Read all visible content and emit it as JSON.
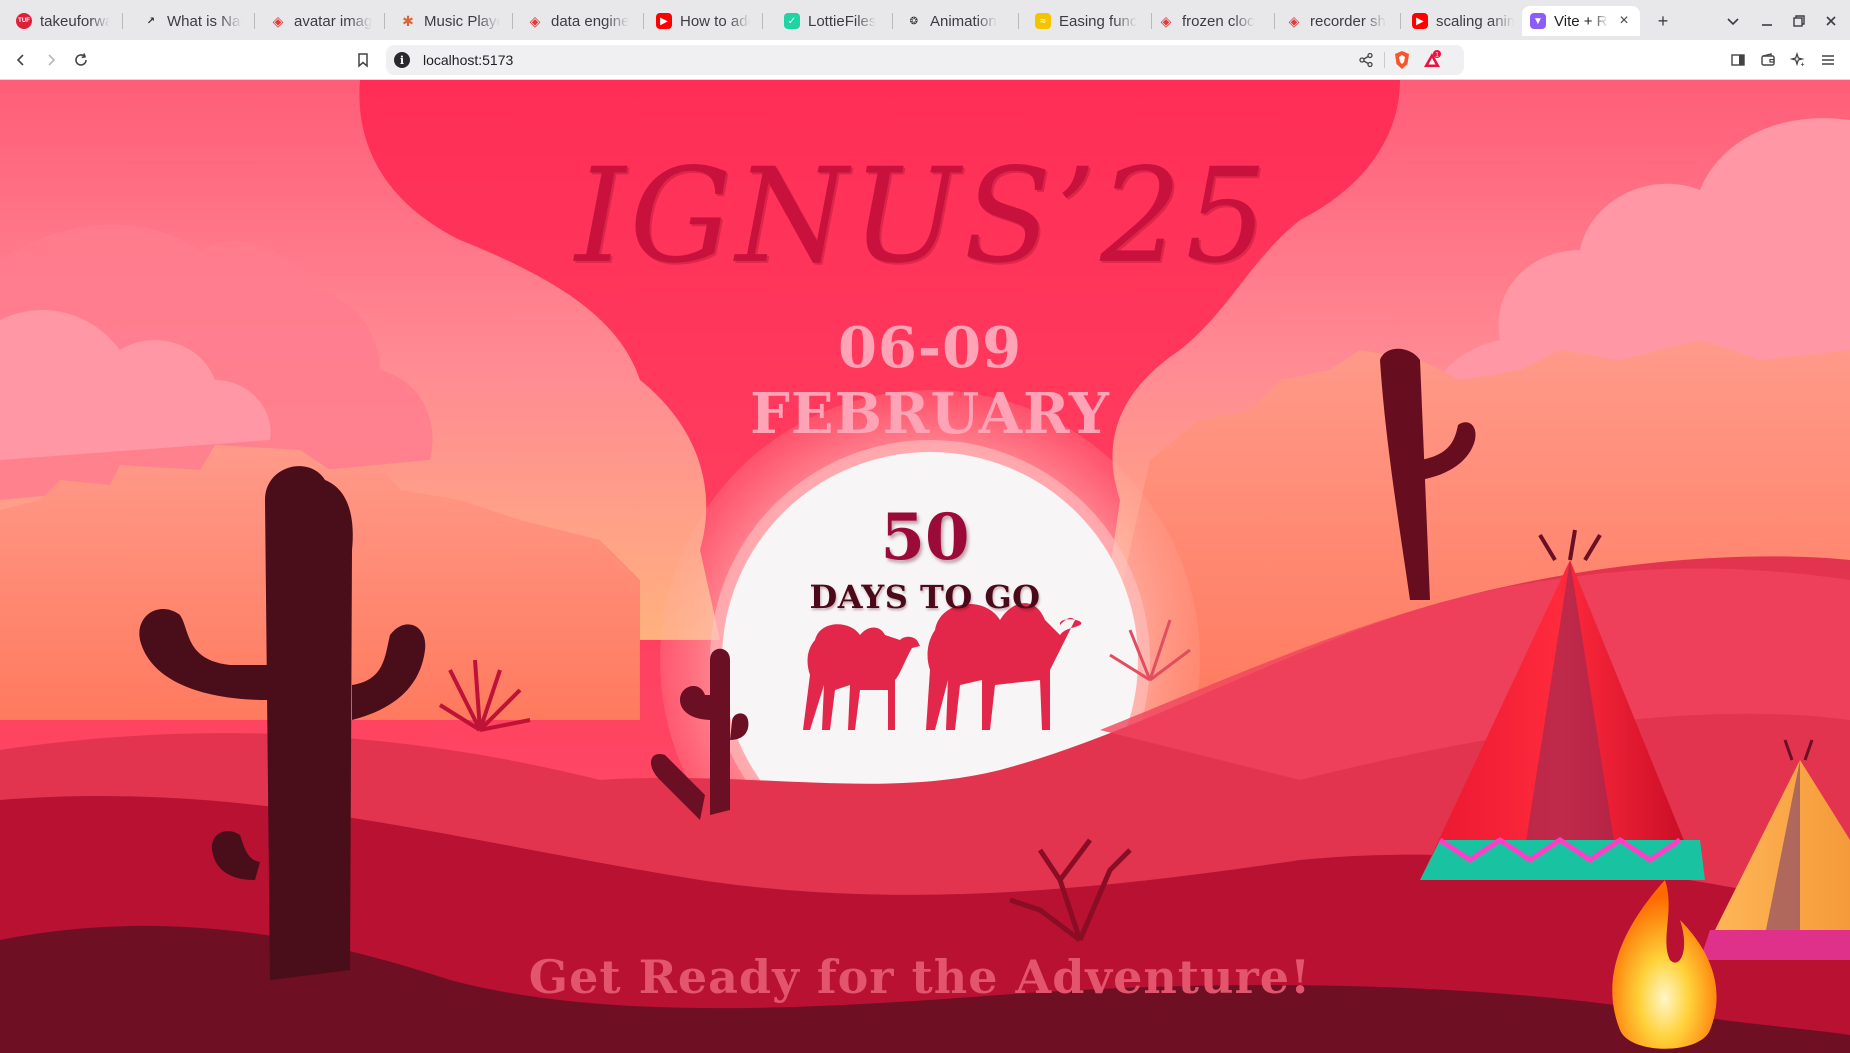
{
  "browser": {
    "tabs": [
      {
        "title": "takeuforwa",
        "icon": "tuf-icon",
        "color": "#e0203a"
      },
      {
        "title": "What is Nat",
        "icon": "chart-line-icon",
        "color": "#2a2a2e"
      },
      {
        "title": "avatar imag",
        "icon": "brave-shield-icon",
        "color": "#e33a3a"
      },
      {
        "title": "Music Playe",
        "icon": "asterisk-icon",
        "color": "#d9653b"
      },
      {
        "title": "data engine",
        "icon": "brave-shield-icon",
        "color": "#e33a3a"
      },
      {
        "title": "How to add",
        "icon": "youtube-icon",
        "color": "#ff0000"
      },
      {
        "title": "LottieFiles",
        "icon": "lottie-icon",
        "color": "#1fd3a2"
      },
      {
        "title": "Animation",
        "icon": "openai-icon",
        "color": "#2a2a2e"
      },
      {
        "title": "Easing func",
        "icon": "easings-icon",
        "color": "#f5c400"
      },
      {
        "title": "frozen cloc",
        "icon": "brave-shield-icon",
        "color": "#e33a3a"
      },
      {
        "title": "recorder sh",
        "icon": "brave-shield-icon",
        "color": "#e33a3a"
      },
      {
        "title": "scaling anim",
        "icon": "youtube-icon",
        "color": "#ff0000"
      },
      {
        "title": "Vite + R",
        "icon": "vite-icon",
        "color": "#8b5cf6",
        "active": true
      }
    ],
    "new_tab": "+",
    "address": "localhost:5173",
    "notification_count": "1"
  },
  "page": {
    "headline": "IGNUS’25",
    "dates": "06-09 FEBRUARY",
    "countdown_number": "50",
    "countdown_label": "DAYS TO GO",
    "tagline": "Get Ready for the Adventure!",
    "colors": {
      "sky": "#ff2e57",
      "cloud": "#ff6f86",
      "sun": "#f7f5f6",
      "dune_front": "#6e0f23",
      "cactus": "#4a0d1a",
      "headline": "#c8123d",
      "dates": "#ffa3b6",
      "tagline": "#e2556c"
    }
  }
}
